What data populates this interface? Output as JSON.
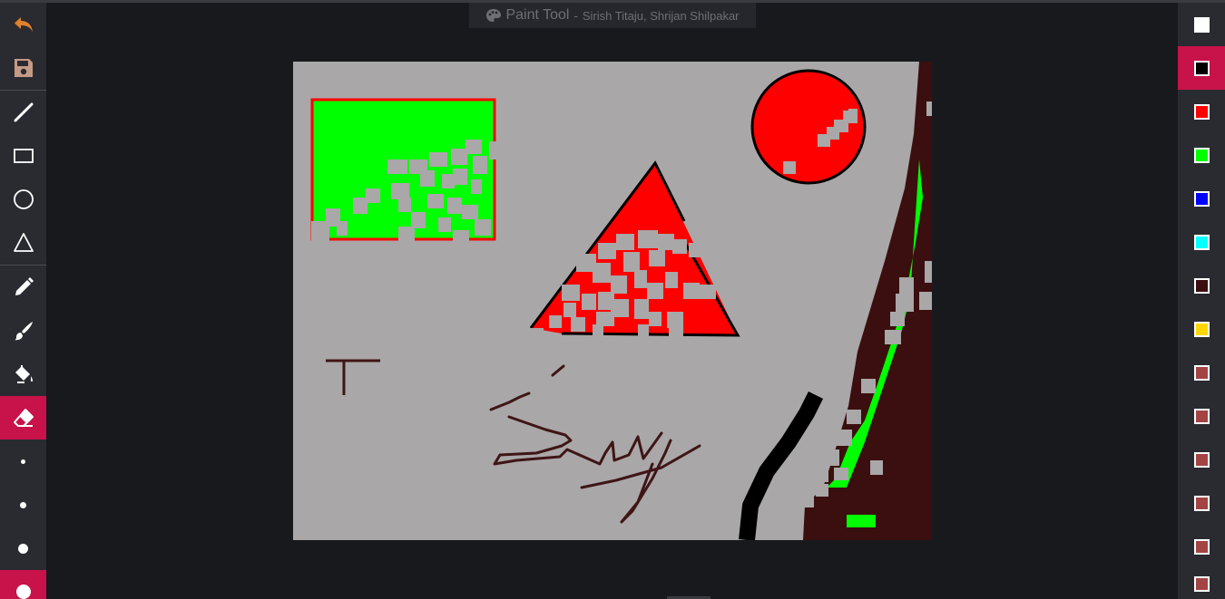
{
  "title": {
    "name": "Paint Tool",
    "separator": "-",
    "authors": "Sirish Titaju, Shrijan Shilpakar"
  },
  "toolbar": {
    "tools": [
      {
        "id": "undo",
        "icon": "undo-icon"
      },
      {
        "id": "save",
        "icon": "save-icon"
      },
      {
        "id": "line",
        "icon": "line-icon"
      },
      {
        "id": "rectangle",
        "icon": "rectangle-icon"
      },
      {
        "id": "circle",
        "icon": "circle-icon"
      },
      {
        "id": "triangle",
        "icon": "triangle-icon"
      },
      {
        "id": "pencil",
        "icon": "pencil-icon"
      },
      {
        "id": "brush",
        "icon": "brush-icon"
      },
      {
        "id": "fill",
        "icon": "paint-bucket-icon"
      },
      {
        "id": "eraser",
        "icon": "eraser-icon",
        "active": true
      }
    ],
    "brush_sizes": [
      {
        "size": "1"
      },
      {
        "size": "2"
      },
      {
        "size": "3"
      },
      {
        "size": "4",
        "active": true
      }
    ]
  },
  "palette": {
    "colors": [
      {
        "hex": "#ffffff"
      },
      {
        "hex": "#000000",
        "active": true
      },
      {
        "hex": "#ff0000"
      },
      {
        "hex": "#00ff00"
      },
      {
        "hex": "#0000ff"
      },
      {
        "hex": "#00ffff"
      },
      {
        "hex": "#3b0f0f"
      },
      {
        "hex": "#ffd700"
      },
      {
        "hex": "#a34444"
      },
      {
        "hex": "#a34444"
      },
      {
        "hex": "#a34444"
      },
      {
        "hex": "#a34444"
      },
      {
        "hex": "#a34444"
      },
      {
        "hex": "#a34444"
      }
    ]
  },
  "canvas": {
    "background": "#a9a7a8",
    "drawing_colors": {
      "green": "#00ff00",
      "red": "#ff0000",
      "black": "#000000",
      "dark_brown": "#3b0f0f",
      "eraser": "#a9a7a8",
      "pen": "#3f1515"
    }
  },
  "theme": {
    "background": "#18191d",
    "panel": "#2a2b31",
    "accent": "#c8124a",
    "undo_color": "#e0822a",
    "save_color": "#c59a86"
  }
}
